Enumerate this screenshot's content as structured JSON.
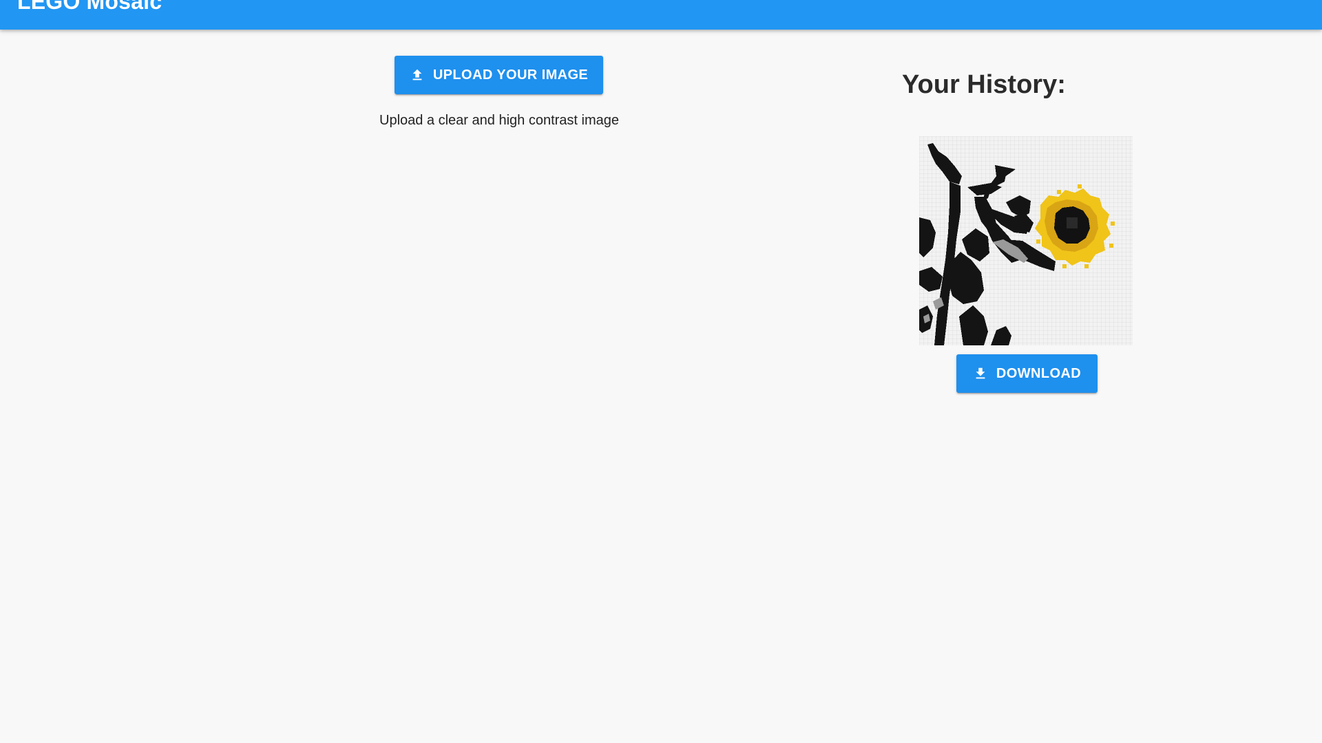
{
  "header": {
    "title": "LEGO Mosaic",
    "color": "#2196f3"
  },
  "upload": {
    "button_label": "UPLOAD YOUR IMAGE",
    "icon": "upload-icon",
    "hint": "Upload a clear and high contrast image"
  },
  "history": {
    "title": "Your History:",
    "items": [
      {
        "image": "sunflower-mosaic",
        "download_label": "DOWNLOAD",
        "download_icon": "download-icon"
      }
    ]
  },
  "colors": {
    "accent": "#2196f3",
    "button": "#1e90ee",
    "background": "#f8f8f8"
  }
}
